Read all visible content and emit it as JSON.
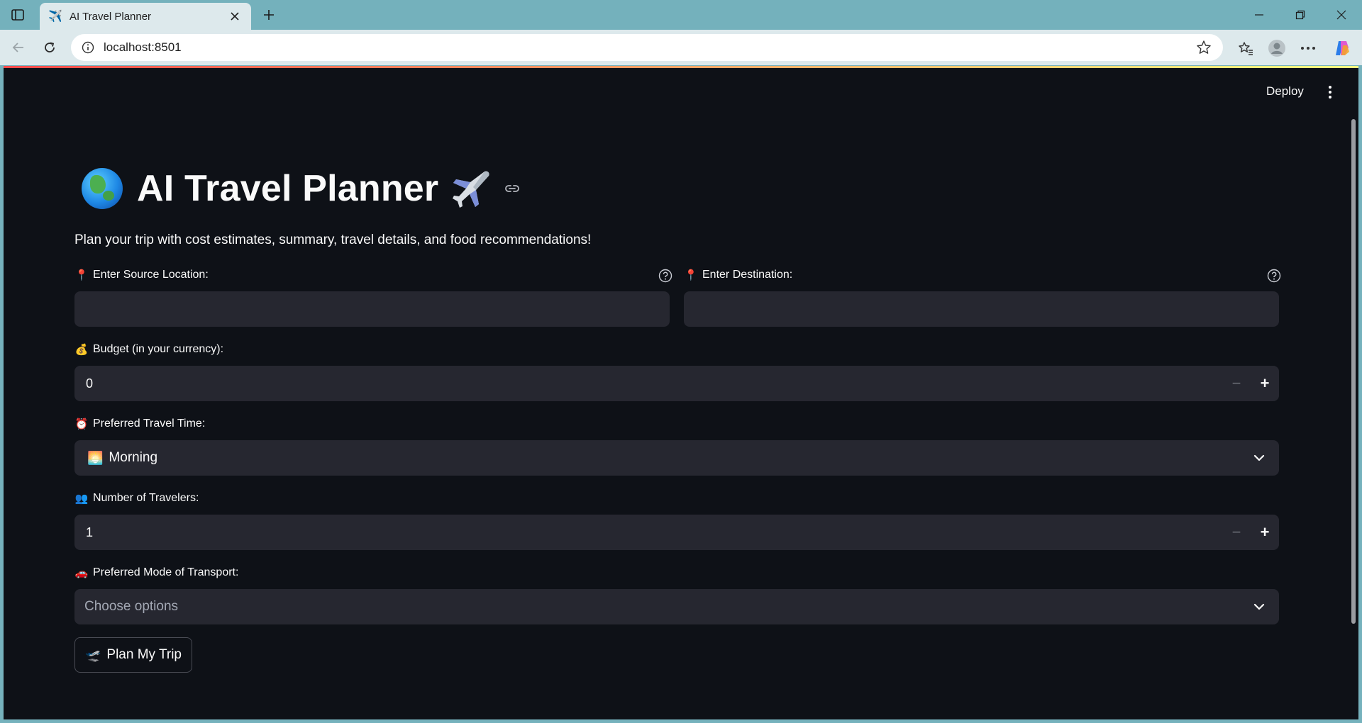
{
  "browser": {
    "tab_title": "AI Travel Planner",
    "url": "localhost:8501"
  },
  "app": {
    "deploy_label": "Deploy",
    "title": "AI Travel Planner",
    "subtitle": "Plan your trip with cost estimates, summary, travel details, and food recommendations!",
    "source": {
      "emoji": "📍",
      "label": "Enter Source Location:",
      "value": ""
    },
    "destination": {
      "emoji": "📍",
      "label": "Enter Destination:",
      "value": ""
    },
    "budget": {
      "emoji": "💰",
      "label": "Budget (in your currency):",
      "value": "0",
      "minus": "−",
      "plus": "+"
    },
    "travel_time": {
      "emoji": "⏰",
      "label": "Preferred Travel Time:",
      "selected_emoji": "🌅",
      "selected": "Morning"
    },
    "travelers": {
      "emoji": "👥",
      "label": "Number of Travelers:",
      "value": "1",
      "minus": "−",
      "plus": "+"
    },
    "transport": {
      "emoji": "🚗",
      "label": "Preferred Mode of Transport:",
      "placeholder": "Choose options"
    },
    "submit": {
      "emoji": "🛫",
      "label": "Plan My Trip"
    }
  },
  "icons": {
    "favicon": "airplane-icon",
    "globe": "globe-icon",
    "plane": "airplane-icon",
    "anchor": "link-icon",
    "help": "question-circle-icon"
  },
  "colors": {
    "app_bg": "#0e1117",
    "input_bg": "#262730",
    "text": "#fafafa",
    "placeholder": "#a3a8b4",
    "accent_line_start": "#ff4b4b",
    "accent_line_end": "#fffd80"
  }
}
